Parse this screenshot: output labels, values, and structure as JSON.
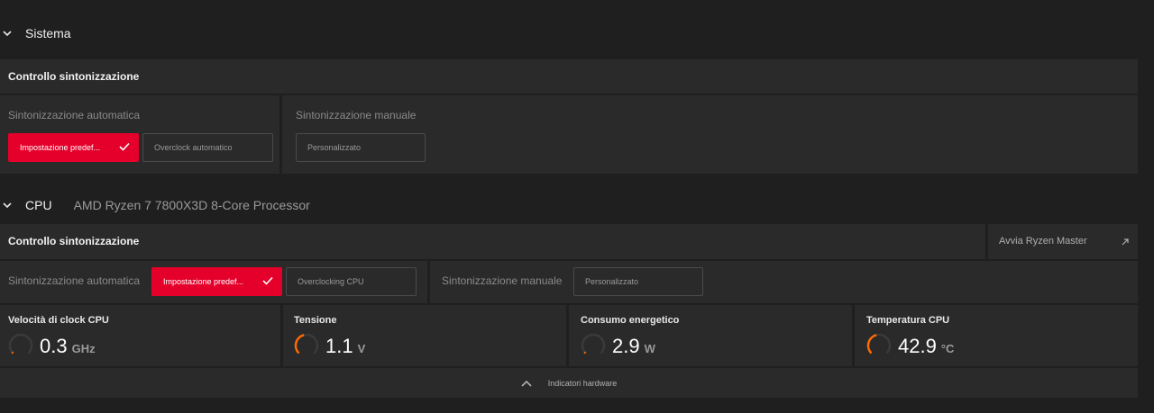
{
  "sistema": {
    "title": "Sistema",
    "card_title": "Controllo sintonizzazione",
    "auto_label": "Sintonizzazione automatica",
    "auto_default_btn": "Impostazione predef...",
    "auto_overclock_btn": "Overclock automatico",
    "manual_label": "Sintonizzazione manuale",
    "manual_btn": "Personalizzato"
  },
  "cpu": {
    "title": "CPU",
    "processor": "AMD Ryzen 7 7800X3D 8-Core Processor",
    "card_title": "Controllo sintonizzazione",
    "ryzen_master": "Avvia Ryzen Master",
    "auto_label": "Sintonizzazione automatica",
    "auto_default_btn": "Impostazione predef...",
    "auto_overclock_btn": "Overclocking CPU",
    "manual_label": "Sintonizzazione manuale",
    "manual_btn": "Personalizzato",
    "metrics": [
      {
        "title": "Velocità di clock CPU",
        "value": "0.3",
        "unit": "GHz",
        "level": 0.02
      },
      {
        "title": "Tensione",
        "value": "1.1",
        "unit": "V",
        "level": 0.45
      },
      {
        "title": "Consumo energetico",
        "value": "2.9",
        "unit": "W",
        "level": 0.02
      },
      {
        "title": "Temperatura CPU",
        "value": "42.9",
        "unit": "°C",
        "level": 0.45
      }
    ],
    "hw_toggle": "Indicatori hardware"
  },
  "colors": {
    "accent": "#e4002b",
    "gauge_active": "#ff6a00",
    "gauge_track": "#3a3a3a"
  }
}
